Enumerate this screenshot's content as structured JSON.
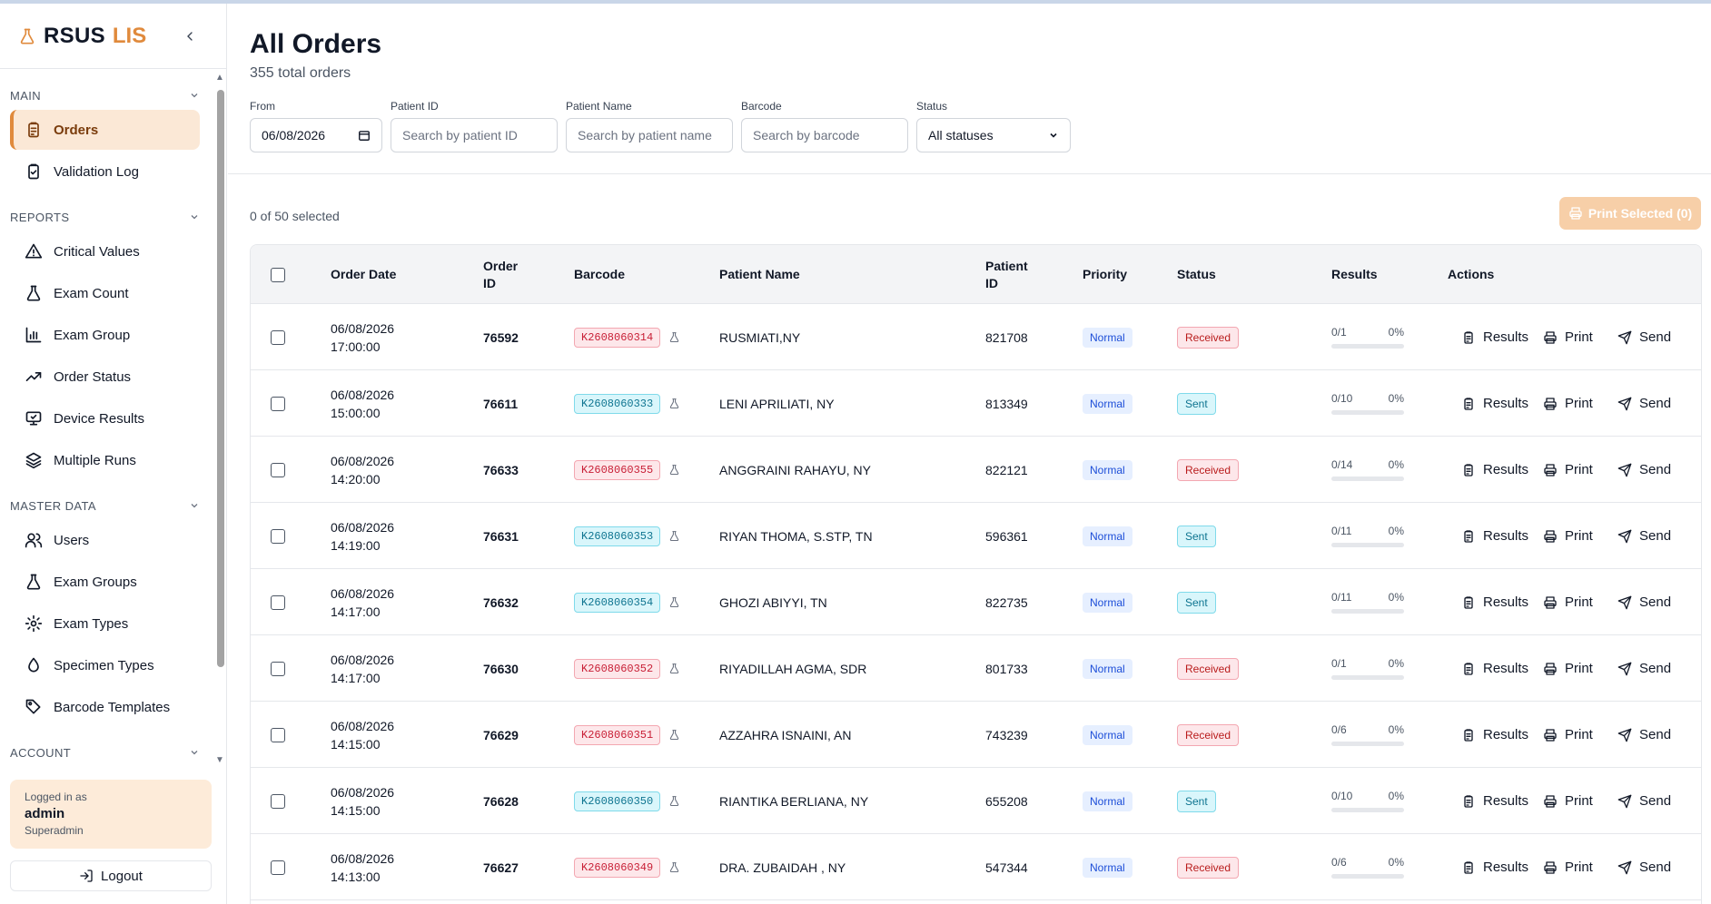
{
  "brand": {
    "name": "RSUS",
    "accent": "LIS"
  },
  "sidebar": {
    "sections": [
      {
        "title": "MAIN",
        "items": [
          {
            "label": "Orders",
            "icon": "clipboard-list-icon",
            "active": true
          },
          {
            "label": "Validation Log",
            "icon": "clipboard-check-icon"
          }
        ]
      },
      {
        "title": "REPORTS",
        "items": [
          {
            "label": "Critical Values",
            "icon": "alert-triangle-icon"
          },
          {
            "label": "Exam Count",
            "icon": "flask-icon"
          },
          {
            "label": "Exam Group",
            "icon": "bar-chart-icon"
          },
          {
            "label": "Order Status",
            "icon": "trending-up-icon"
          },
          {
            "label": "Device Results",
            "icon": "monitor-icon"
          },
          {
            "label": "Multiple Runs",
            "icon": "layers-icon"
          }
        ]
      },
      {
        "title": "MASTER DATA",
        "items": [
          {
            "label": "Users",
            "icon": "users-icon"
          },
          {
            "label": "Exam Groups",
            "icon": "flask-icon"
          },
          {
            "label": "Exam Types",
            "icon": "settings-icon"
          },
          {
            "label": "Specimen Types",
            "icon": "droplet-icon"
          },
          {
            "label": "Barcode Templates",
            "icon": "tag-icon"
          }
        ]
      },
      {
        "title": "ACCOUNT",
        "items": []
      }
    ],
    "user": {
      "logged_in_label": "Logged in as",
      "username": "admin",
      "role": "Superadmin"
    },
    "logout_label": "Logout"
  },
  "page": {
    "title": "All Orders",
    "subtitle": "355 total orders"
  },
  "filters": {
    "from": {
      "label": "From",
      "value": "06/08/2026"
    },
    "patient_id": {
      "label": "Patient ID",
      "placeholder": "Search by patient ID"
    },
    "patient_name": {
      "label": "Patient Name",
      "placeholder": "Search by patient name"
    },
    "barcode": {
      "label": "Barcode",
      "placeholder": "Search by barcode"
    },
    "status": {
      "label": "Status",
      "value": "All statuses"
    }
  },
  "selection": {
    "text": "0 of 50 selected",
    "print_label": "Print Selected (0)"
  },
  "table": {
    "columns": {
      "order_date": "Order Date",
      "order_id": "Order ID",
      "barcode": "Barcode",
      "patient_name": "Patient Name",
      "patient_id": "Patient ID",
      "priority": "Priority",
      "status": "Status",
      "results": "Results",
      "actions": "Actions"
    },
    "action_labels": {
      "results": "Results",
      "print": "Print",
      "send": "Send"
    },
    "rows": [
      {
        "date": "06/08/2026",
        "time": "17:00:00",
        "order_id": "76592",
        "barcode": "K2608060314",
        "barcode_color": "red",
        "patient_name": "RUSMIATI,NY",
        "patient_id": "821708",
        "priority": "Normal",
        "status": "Received",
        "results": "0/1",
        "percent": "0%",
        "progress": 0
      },
      {
        "date": "06/08/2026",
        "time": "15:00:00",
        "order_id": "76611",
        "barcode": "K2608060333",
        "barcode_color": "cyan",
        "patient_name": "LENI APRILIATI, NY",
        "patient_id": "813349",
        "priority": "Normal",
        "status": "Sent",
        "results": "0/10",
        "percent": "0%",
        "progress": 0
      },
      {
        "date": "06/08/2026",
        "time": "14:20:00",
        "order_id": "76633",
        "barcode": "K2608060355",
        "barcode_color": "red",
        "patient_name": "ANGGRAINI RAHAYU, NY",
        "patient_id": "822121",
        "priority": "Normal",
        "status": "Received",
        "results": "0/14",
        "percent": "0%",
        "progress": 0
      },
      {
        "date": "06/08/2026",
        "time": "14:19:00",
        "order_id": "76631",
        "barcode": "K2608060353",
        "barcode_color": "cyan",
        "patient_name": "RIYAN THOMA, S.STP, TN",
        "patient_id": "596361",
        "priority": "Normal",
        "status": "Sent",
        "results": "0/11",
        "percent": "0%",
        "progress": 0
      },
      {
        "date": "06/08/2026",
        "time": "14:17:00",
        "order_id": "76632",
        "barcode": "K2608060354",
        "barcode_color": "cyan",
        "patient_name": "GHOZI ABIYYI, TN",
        "patient_id": "822735",
        "priority": "Normal",
        "status": "Sent",
        "results": "0/11",
        "percent": "0%",
        "progress": 0
      },
      {
        "date": "06/08/2026",
        "time": "14:17:00",
        "order_id": "76630",
        "barcode": "K2608060352",
        "barcode_color": "red",
        "patient_name": "RIYADILLAH AGMA, SDR",
        "patient_id": "801733",
        "priority": "Normal",
        "status": "Received",
        "results": "0/1",
        "percent": "0%",
        "progress": 0
      },
      {
        "date": "06/08/2026",
        "time": "14:15:00",
        "order_id": "76629",
        "barcode": "K2608060351",
        "barcode_color": "red",
        "patient_name": "AZZAHRA ISNAINI, AN",
        "patient_id": "743239",
        "priority": "Normal",
        "status": "Received",
        "results": "0/6",
        "percent": "0%",
        "progress": 0
      },
      {
        "date": "06/08/2026",
        "time": "14:15:00",
        "order_id": "76628",
        "barcode": "K2608060350",
        "barcode_color": "cyan",
        "patient_name": "RIANTIKA BERLIANA, NY",
        "patient_id": "655208",
        "priority": "Normal",
        "status": "Sent",
        "results": "0/10",
        "percent": "0%",
        "progress": 0
      },
      {
        "date": "06/08/2026",
        "time": "14:13:00",
        "order_id": "76627",
        "barcode": "K2608060349",
        "barcode_color": "red",
        "patient_name": "DRA. ZUBAIDAH , NY",
        "patient_id": "547344",
        "priority": "Normal",
        "status": "Received",
        "results": "0/6",
        "percent": "0%",
        "progress": 0
      }
    ]
  },
  "colors": {
    "accent": "#e08a3c",
    "accent_bg": "#fbe8d6",
    "received": "#b91c1c",
    "sent": "#0e7490",
    "priority": "#1d4ed8"
  }
}
